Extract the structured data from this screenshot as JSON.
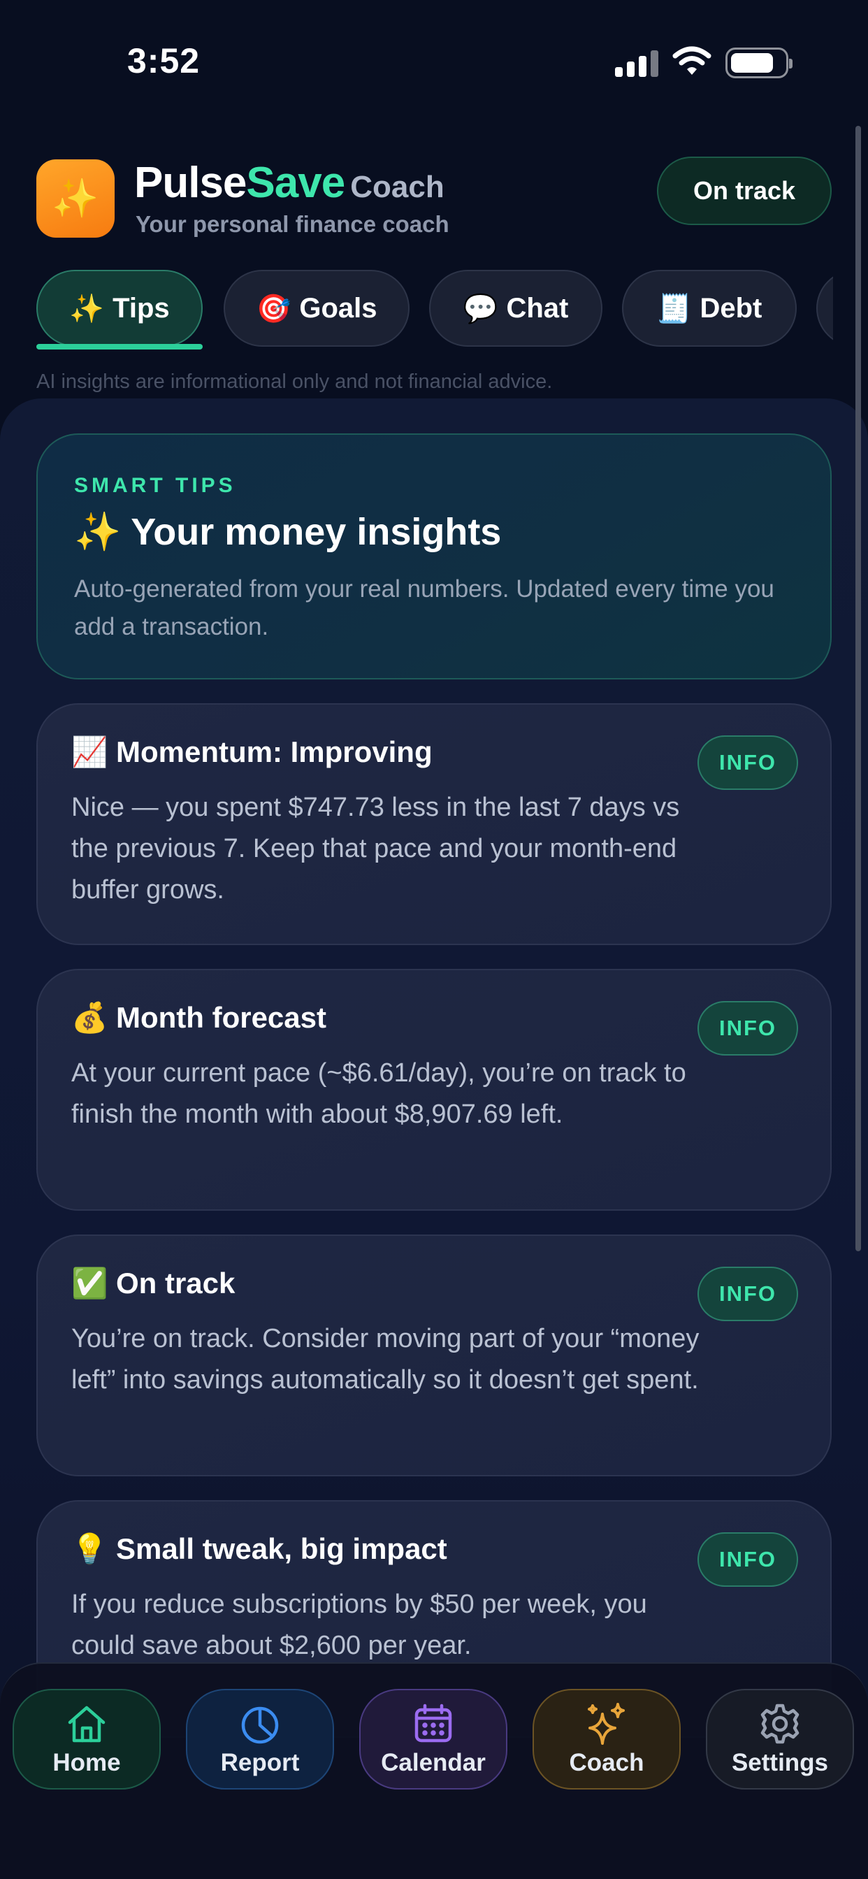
{
  "status": {
    "time": "3:52"
  },
  "header": {
    "brand_part1": "Pulse",
    "brand_part2": "Save",
    "brand_suffix": "Coach",
    "subtitle": "Your personal finance coach",
    "status_pill": "On track",
    "app_icon": "sparkles-icon"
  },
  "tabs": [
    {
      "icon": "✨",
      "label": "Tips",
      "active": true
    },
    {
      "icon": "🎯",
      "label": "Goals",
      "active": false
    },
    {
      "icon": "💬",
      "label": "Chat",
      "active": false
    },
    {
      "icon": "🧾",
      "label": "Debt",
      "active": false
    }
  ],
  "disclaimer": "AI insights are informational only and not financial advice.",
  "hero": {
    "kicker": "SMART TIPS",
    "icon": "✨",
    "title": "Your money insights",
    "description": "Auto-generated from your real numbers. Updated every time you add a transaction."
  },
  "cards": [
    {
      "icon": "📈",
      "title": "Momentum: Improving",
      "badge": "INFO",
      "body": "Nice — you spent $747.73 less in the last 7 days vs the previous 7. Keep that pace and your month-end buffer grows."
    },
    {
      "icon": "💰",
      "title": "Month forecast",
      "badge": "INFO",
      "body": "At your current pace (~$6.61/day), you’re on track to finish the month with about $8,907.69 left."
    },
    {
      "icon": "✅",
      "title": "On track",
      "badge": "INFO",
      "body": "You’re on track. Consider moving part of your “money left” into savings automatically so it doesn’t get spent."
    },
    {
      "icon": "💡",
      "title": "Small tweak, big impact",
      "badge": "INFO",
      "body": "If you reduce subscriptions by $50 per week, you could save about $2,600 per year."
    }
  ],
  "nav": [
    {
      "label": "Home",
      "icon": "home-icon",
      "color": "#2ccf9a"
    },
    {
      "label": "Report",
      "icon": "pie-chart-icon",
      "color": "#3b8cf0"
    },
    {
      "label": "Calendar",
      "icon": "calendar-icon",
      "color": "#9b6cf0"
    },
    {
      "label": "Coach",
      "icon": "sparkles-icon",
      "color": "#e8a53a"
    },
    {
      "label": "Settings",
      "icon": "gear-icon",
      "color": "#9aa2b2"
    }
  ]
}
